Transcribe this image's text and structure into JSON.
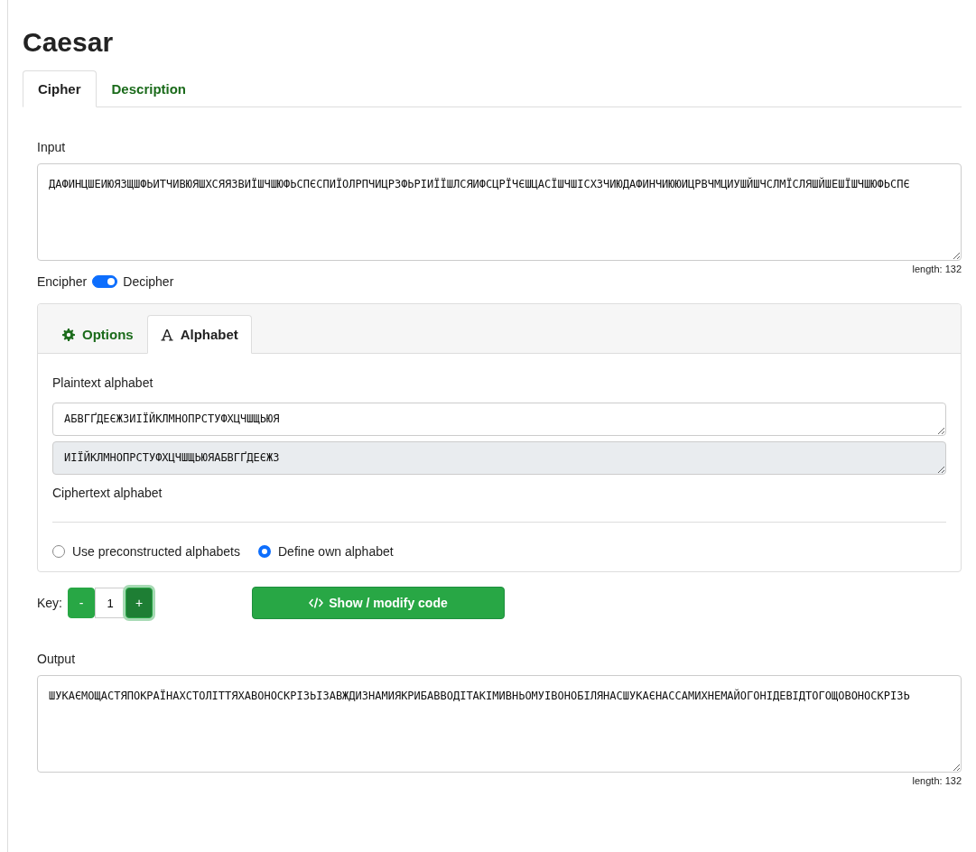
{
  "title": "Caesar",
  "tabs": [
    {
      "label": "Cipher",
      "selected": true
    },
    {
      "label": "Description",
      "selected": false
    }
  ],
  "input": {
    "label": "Input",
    "value": "ДАФИНЦШЕИЮЯЗЩШФЬИТЧИВЮЯШХСЯЯЗВИЇШЧШЮФЬСПЄСПИЇОЛРПЧИЦРЗФЬРІИЇЇШЛСЯИФСЦРЇЧЄШЦАСЇШЧШІСХЗЧИЮДАФИНЧИЮЮИЦРВЧМЦИУШЙШЧСЛМЇСЛЯШЙШЕШЇШЧШЮФЬСПЄ",
    "length": "length: 132"
  },
  "mode": {
    "left": "Encipher",
    "right": "Decipher",
    "on": true
  },
  "panel_tabs": [
    {
      "label": "Options",
      "kind": "gear",
      "selected": false
    },
    {
      "label": "Alphabet",
      "kind": "letter",
      "selected": true
    }
  ],
  "plaintext_alphabet": {
    "label": "Plaintext alphabet",
    "value": "АБВГҐДЕЄЖЗИІЇЙКЛМНОПРСТУФХЦЧШЩЬЮЯ"
  },
  "ciphertext_alphabet": {
    "label": "Ciphertext alphabet",
    "value": "ИІЇЙКЛМНОПРСТУФХЦЧШЩЬЮЯАБВГҐДЕЄЖЗ"
  },
  "alphabet_options": [
    {
      "label": "Use preconstructed alphabets",
      "selected": false
    },
    {
      "label": "Define own alphabet",
      "selected": true
    }
  ],
  "key": {
    "label": "Key:",
    "minus": "-",
    "value": "1",
    "plus": "+"
  },
  "code_button": "Show / modify code",
  "output": {
    "label": "Output",
    "value": "ШУКАЄМОЩАСТЯПОКРАЇНАХСТОЛІТТЯХАВОНОСКРІЗЬІЗАВЖДИЗНАМИЯКРИБАВВОДІТАКІМИВНЬОМУІВОНОБІЛЯНАСШУКАЄНАССАМИХНЕМАЙОГОНІДЕВІДТОГОЩОВОНОСКРІЗЬ",
    "length": "length: 132"
  }
}
